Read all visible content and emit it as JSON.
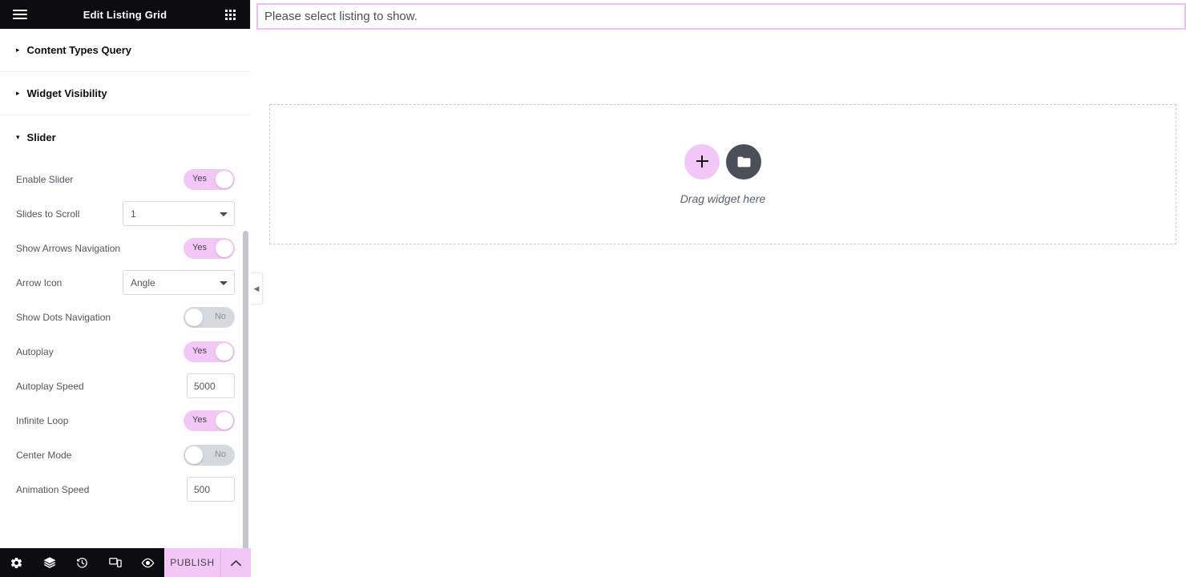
{
  "panel": {
    "header": {
      "title": "Edit Listing Grid",
      "menu_icon": "hamburger-icon",
      "apps_icon": "grid-apps-icon"
    },
    "sections": [
      {
        "label": "Content Types Query",
        "expanded": false,
        "caret": "▸"
      },
      {
        "label": "Widget Visibility",
        "expanded": false,
        "caret": "▸"
      },
      {
        "label": "Slider",
        "expanded": true,
        "caret": "▾"
      }
    ],
    "controls": [
      {
        "label": "Enable Slider",
        "type": "switcher",
        "value": "Yes",
        "state": "on"
      },
      {
        "label": "Slides to Scroll",
        "type": "select",
        "value": "1"
      },
      {
        "label": "Show Arrows Navigation",
        "type": "switcher",
        "value": "Yes",
        "state": "on"
      },
      {
        "label": "Arrow Icon",
        "type": "select",
        "value": "Angle"
      },
      {
        "label": "Show Dots Navigation",
        "type": "switcher",
        "value": "No",
        "state": "off"
      },
      {
        "label": "Autoplay",
        "type": "switcher",
        "value": "Yes",
        "state": "on"
      },
      {
        "label": "Autoplay Speed",
        "type": "number",
        "value": "5000"
      },
      {
        "label": "Infinite Loop",
        "type": "switcher",
        "value": "Yes",
        "state": "on"
      },
      {
        "label": "Center Mode",
        "type": "switcher",
        "value": "No",
        "state": "off"
      },
      {
        "label": "Animation Speed",
        "type": "number",
        "value": "500"
      }
    ],
    "collapse_handle_icon": "chevron-left-icon",
    "footer": {
      "tools": [
        {
          "name": "settings-gear-icon"
        },
        {
          "name": "navigator-layers-icon"
        },
        {
          "name": "history-clock-icon"
        },
        {
          "name": "responsive-mode-icon"
        },
        {
          "name": "preview-eye-icon"
        }
      ],
      "publish_label": "PUBLISH",
      "publish_caret_icon": "chevron-up-icon"
    }
  },
  "canvas": {
    "notice": "Please select listing to show.",
    "dropzone": {
      "add_icon": "plus-icon",
      "folder_icon": "folder-icon",
      "label": "Drag widget here"
    }
  },
  "colors": {
    "accent_pink": "#f3c7f5",
    "notice_border": "#f0befa",
    "panel_header_bg": "#0d0d11",
    "toggle_off_bg": "#d5d8dc",
    "folder_btn_bg": "#4b5058"
  }
}
